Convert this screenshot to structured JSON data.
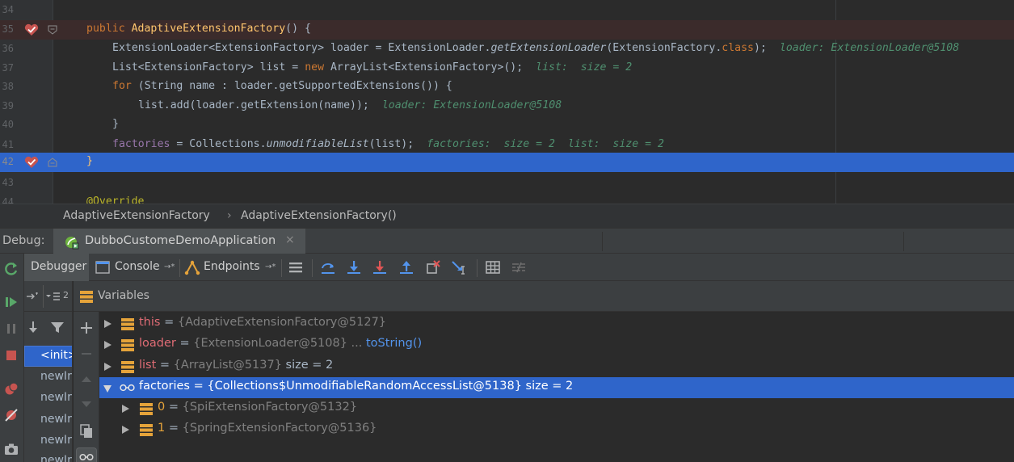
{
  "editor": {
    "lines": [
      {
        "num": "34"
      },
      {
        "num": "35"
      },
      {
        "num": "36"
      },
      {
        "num": "37"
      },
      {
        "num": "38"
      },
      {
        "num": "39"
      },
      {
        "num": "40"
      },
      {
        "num": "41"
      },
      {
        "num": "42"
      },
      {
        "num": "43"
      },
      {
        "num": "44"
      }
    ],
    "code": {
      "l35_kw": "public ",
      "l35_fn": "AdaptiveExtensionFactory",
      "l35_rest": "() {",
      "l36_a": "ExtensionLoader<ExtensionFactory> loader = ExtensionLoader.",
      "l36_b": "getExtensionLoader",
      "l36_c": "(ExtensionFactory.",
      "l36_kw": "class",
      "l36_d": ");",
      "l36_inline": "loader: ExtensionLoader@5108",
      "l37_a": "List<ExtensionFactory> list = ",
      "l37_kw": "new ",
      "l37_b": "ArrayList<ExtensionFactory>();",
      "l37_inline": "list:  size = 2",
      "l38_kw": "for ",
      "l38_a": "(String name : loader.getSupportedExtensions()) {",
      "l39_a": "list.add(loader.getExtension(name));",
      "l39_inline": "loader: ExtensionLoader@5108",
      "l40_a": "}",
      "l41_fld": "factories",
      "l41_a": " = Collections.",
      "l41_b": "unmodifiableList",
      "l41_c": "(list);",
      "l41_inline": "factories:  size = 2  list:  size = 2",
      "l42_a": "}",
      "l44_ann": "@Override"
    }
  },
  "breadcrumb": {
    "class_name": "AdaptiveExtensionFactory",
    "separator": "›",
    "method_name": "AdaptiveExtensionFactory()"
  },
  "debug": {
    "label": "Debug:",
    "run_config": "DubboCustomeDemoApplication",
    "close": "×"
  },
  "toolbar": {
    "debugger": "Debugger",
    "console": "Console",
    "console_pin": "→*",
    "endpoints": "Endpoints",
    "endpoints_pin": "→*"
  },
  "frames": {
    "thread_count": "2",
    "items": [
      "<init>",
      "newIr",
      "newIr",
      "newIr",
      "newIr",
      "newIr"
    ]
  },
  "variables": {
    "title": "Variables",
    "rows": [
      {
        "name": "this",
        "eq": " = ",
        "value": "{AdaptiveExtensionFactory@5127}",
        "extra": ""
      },
      {
        "name": "loader",
        "eq": " = ",
        "value": "{ExtensionLoader@5108}",
        "extra": " ... ",
        "link": "toString()"
      },
      {
        "name": "list",
        "eq": " = ",
        "value": "{ArrayList@5137}",
        "extra": "  size = 2"
      },
      {
        "name": "factories",
        "eq": " = ",
        "value": "{Collections$UnmodifiableRandomAccessList@5138}",
        "extra": "  size = 2"
      },
      {
        "name": "0",
        "eq": " = ",
        "value": "{SpiExtensionFactory@5132}",
        "extra": ""
      },
      {
        "name": "1",
        "eq": " = ",
        "value": "{SpringExtensionFactory@5136}",
        "extra": ""
      }
    ]
  },
  "colors": {
    "selection": "#2f65ca",
    "breakpoint": "#c75450",
    "keyword": "#cc7832",
    "inline_value": "#4f8f6f"
  }
}
